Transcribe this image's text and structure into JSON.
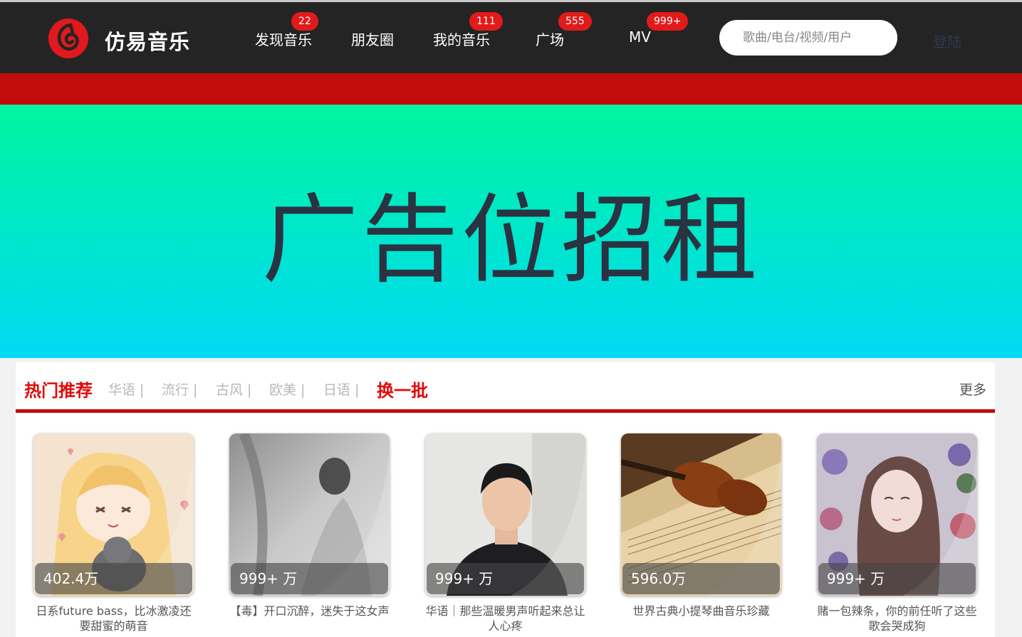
{
  "header": {
    "logo_text": "仿易音乐",
    "nav": [
      {
        "label": "发现音乐",
        "badge": "22"
      },
      {
        "label": "朋友圈",
        "badge": ""
      },
      {
        "label": "我的音乐",
        "badge": "111"
      },
      {
        "label": "广场",
        "badge": "555"
      },
      {
        "label": "MV",
        "badge": "999+"
      }
    ],
    "search_placeholder": "歌曲/电台/视频/用户",
    "login_label": "登陆"
  },
  "banner": {
    "text": "广告位招租"
  },
  "hot": {
    "title": "热门推荐",
    "tags": [
      "华语 |",
      "流行 |",
      "古风 |",
      "欧美 |",
      "日语 |"
    ],
    "refresh_label": "换一批",
    "more_label": "更多",
    "cards": [
      {
        "count": "402.4万",
        "title": "日系future bass，比冰激凌还要甜蜜的萌音",
        "cover": "anime-girl-cat"
      },
      {
        "count": "999+ 万",
        "title": "【毒】开口沉醉，迷失于这女声",
        "cover": "blurred-woman-bw"
      },
      {
        "count": "999+ 万",
        "title": "华语｜那些温暖男声听起来总让人心疼",
        "cover": "young-man-portrait"
      },
      {
        "count": "596.0万",
        "title": "世界古典小提琴曲音乐珍藏",
        "cover": "violin-sheet-music"
      },
      {
        "count": "999+ 万",
        "title": "赌一包辣条，你的前任听了这些歌会哭成狗",
        "cover": "girl-with-flowers"
      }
    ]
  },
  "colors": {
    "header_bg": "#242424",
    "accent_red": "#c20c0c",
    "badge_red": "#e11a1a",
    "banner_top": "#00f5a0",
    "banner_bottom": "#00d9f5"
  }
}
